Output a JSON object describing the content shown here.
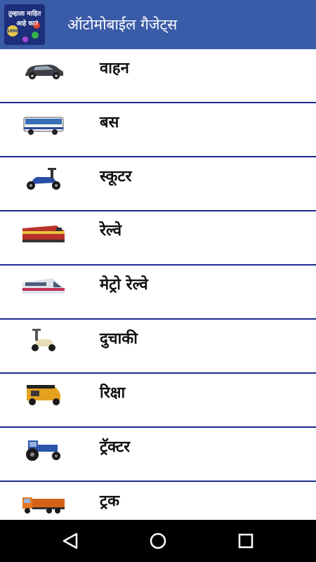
{
  "header": {
    "title": "ऑटोमोबाईल गैजेट्स",
    "logo_text_line1": "तुम्हाला माहित",
    "logo_text_line2": "आहे का?",
    "logo_badge": "1000"
  },
  "colors": {
    "appbar": "#3a5ba8",
    "divider": "#1b2a8e",
    "navbar": "#000000"
  },
  "items": [
    {
      "label": "वाहन",
      "icon": "car-icon"
    },
    {
      "label": "बस",
      "icon": "bus-icon"
    },
    {
      "label": "स्कूटर",
      "icon": "scooter-icon"
    },
    {
      "label": "रेल्वे",
      "icon": "locomotive-icon"
    },
    {
      "label": "मेट्रो रेल्वे",
      "icon": "metro-train-icon"
    },
    {
      "label": "दुचाकी",
      "icon": "two-wheeler-icon"
    },
    {
      "label": "रिक्षा",
      "icon": "auto-rickshaw-icon"
    },
    {
      "label": "ट्रॅक्टर",
      "icon": "tractor-icon"
    },
    {
      "label": "ट्रक",
      "icon": "truck-icon"
    }
  ],
  "navbar": {
    "back_icon": "back-triangle-icon",
    "home_icon": "home-circle-icon",
    "recents_icon": "recents-square-icon"
  }
}
